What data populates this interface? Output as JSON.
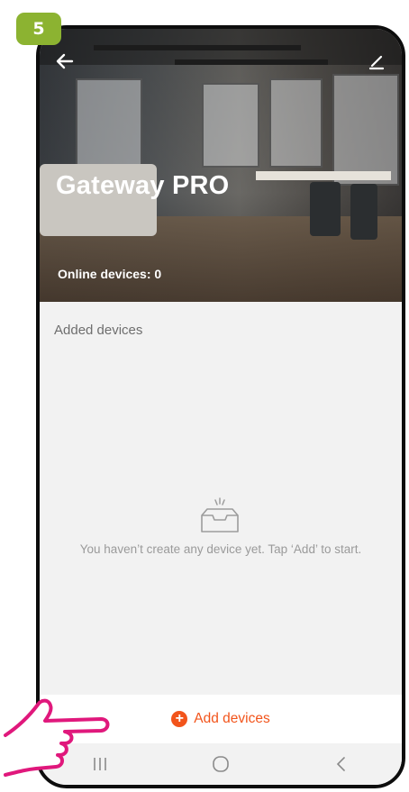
{
  "step_badge": "5",
  "header": {
    "title": "Gateway PRO",
    "online_devices": "Online devices: 0",
    "back_icon": "arrow-left-icon",
    "edit_icon": "pencil-icon"
  },
  "devices_section": {
    "label": "Added devices",
    "empty_icon": "empty-inbox-icon",
    "empty_message": "You haven’t create any device yet. Tap ‘Add’ to start."
  },
  "add_button": {
    "icon": "plus-circle-icon",
    "label": "Add devices"
  },
  "navbar": {
    "recent_icon": "recent-apps-icon",
    "home_icon": "home-icon",
    "back_icon": "back-chevron-icon"
  },
  "colors": {
    "accent": "#f2541b",
    "badge": "#8cb331",
    "hand_outline": "#e0187c",
    "background": "#f2f2f2"
  }
}
